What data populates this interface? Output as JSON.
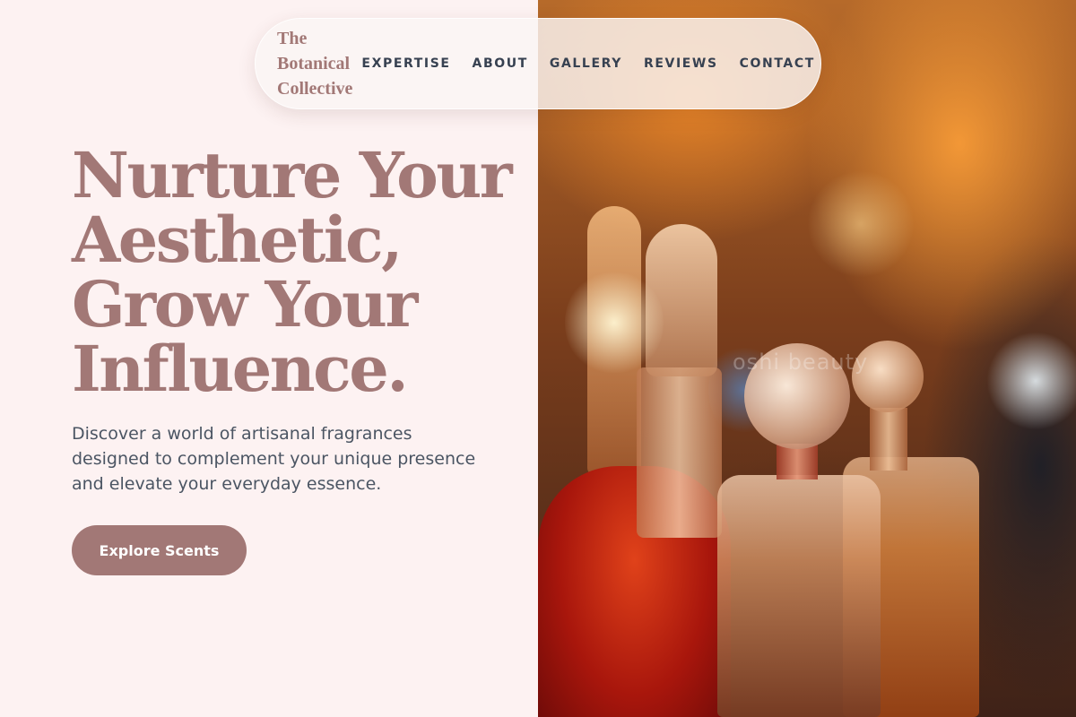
{
  "brand": {
    "logo_lines": [
      "The",
      "Botanical",
      "Collective"
    ]
  },
  "nav": {
    "items": [
      {
        "label": "EXPERTISE"
      },
      {
        "label": "ABOUT"
      },
      {
        "label": "GALLERY"
      },
      {
        "label": "REVIEWS"
      },
      {
        "label": "CONTACT"
      }
    ]
  },
  "hero": {
    "title_lines": [
      "Nurture Your",
      "Aesthetic,",
      "Grow Your",
      "Influence."
    ],
    "description": "Discover a world of artisanal fragrances designed to complement your unique presence and elevate your everyday essence.",
    "cta_label": "Explore Scents"
  },
  "photo": {
    "subject": "perfume-bottles-photo",
    "watermark_text": "oshi beauty"
  },
  "colors": {
    "accent": "#a27876",
    "page_background": "#fdf2f2",
    "body_text": "#4b5563",
    "nav_text": "#374151",
    "button_text": "#ffffff"
  }
}
